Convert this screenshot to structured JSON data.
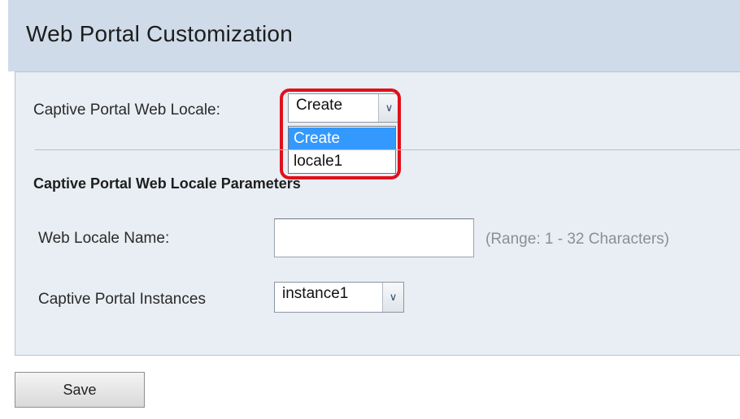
{
  "page": {
    "title": "Web Portal Customization"
  },
  "locale": {
    "label": "Captive Portal Web Locale:",
    "selected": "Create",
    "dropdown_open": true,
    "options": [
      "Create",
      "locale1"
    ]
  },
  "parameters": {
    "section_title": "Captive Portal Web Locale Parameters",
    "web_locale_name": {
      "label": "Web Locale Name:",
      "value": "",
      "hint": "(Range: 1 - 32 Characters)"
    },
    "instances": {
      "label": "Captive Portal Instances",
      "selected": "instance1"
    }
  },
  "actions": {
    "save_label": "Save"
  },
  "colors": {
    "header_bg": "#cfdbe9",
    "panel_bg": "#e9eef4",
    "highlight": "#e0101b",
    "selected_option": "#3399ff"
  },
  "icons": {
    "dropdown_arrow": "chevron-down-icon"
  }
}
